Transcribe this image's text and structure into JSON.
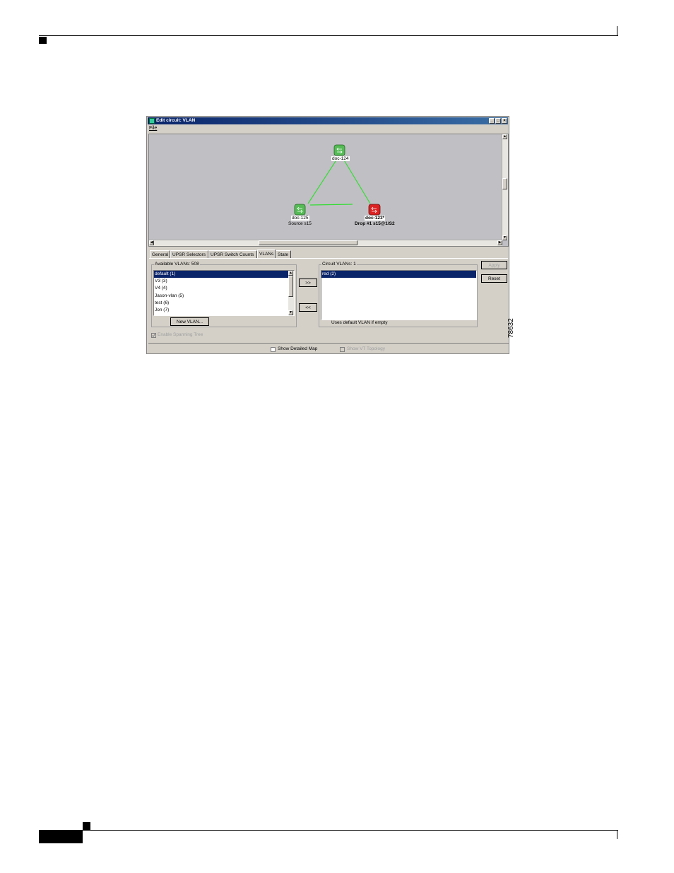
{
  "window": {
    "title": "Edit circuit: VLAN",
    "menu": [
      "File"
    ],
    "controls": [
      "_",
      "□",
      "×"
    ]
  },
  "map": {
    "nodes": [
      {
        "label": "doc-124",
        "sublabel": "",
        "status": "ok"
      },
      {
        "label": "doc-125",
        "sublabel": "Source s15",
        "status": "ok"
      },
      {
        "label": "doc-123*",
        "sublabel": "Drop #1 s15@1/S2",
        "status": "alarm"
      }
    ]
  },
  "tabs": [
    "General",
    "UPSR Selectors",
    "UPSR Switch Counts",
    "VLANs",
    "State"
  ],
  "active_tab": "VLANs",
  "available": {
    "title": "Available VLANs: 508",
    "items": [
      "default (1)",
      "V3 (3)",
      "V4 (4)",
      "Jason-vlan (5)",
      "test (6)",
      "Jon (7)"
    ],
    "selected_index": 0,
    "new_button": "New VLAN..."
  },
  "move_buttons": {
    "add": ">>",
    "remove": "<<"
  },
  "circuit": {
    "title": "Circuit VLANs: 1",
    "items": [
      "red (2)"
    ],
    "note": "Uses default VLAN if empty"
  },
  "actions": {
    "apply": "Apply",
    "reset": "Reset"
  },
  "spanning_tree": {
    "label": "Enable Spanning Tree",
    "checked": true,
    "enabled": false
  },
  "bottom": {
    "show_map": {
      "label": "Show Detailed Map",
      "checked": false
    },
    "show_topology": {
      "label": "Show VT Topology",
      "checked": false,
      "enabled": false
    }
  },
  "figure_number": "78632"
}
